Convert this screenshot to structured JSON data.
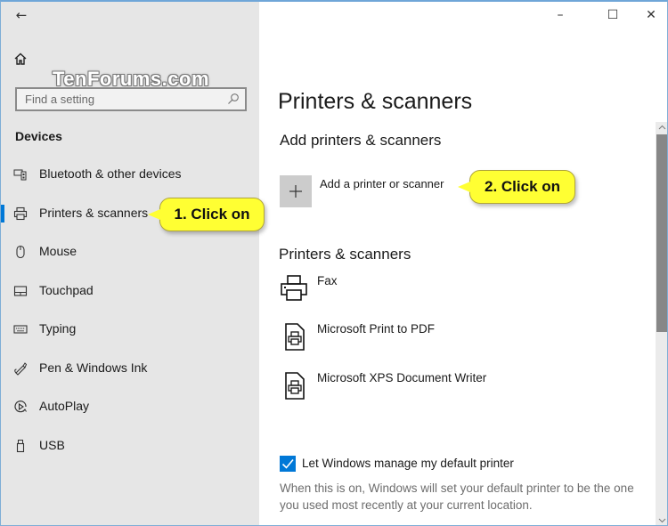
{
  "window": {
    "minimize_glyph": "–",
    "maximize_glyph": "☐",
    "close_glyph": "✕"
  },
  "sidebar": {
    "back_glyph": "←",
    "watermark": "TenForums.com",
    "search": {
      "placeholder": "Find a setting",
      "value": ""
    },
    "section_title": "Devices",
    "items": [
      {
        "label": "Bluetooth & other devices",
        "icon": "bluetooth-devices-icon",
        "selected": false
      },
      {
        "label": "Printers & scanners",
        "icon": "printer-icon",
        "selected": true
      },
      {
        "label": "Mouse",
        "icon": "mouse-icon",
        "selected": false
      },
      {
        "label": "Touchpad",
        "icon": "touchpad-icon",
        "selected": false
      },
      {
        "label": "Typing",
        "icon": "keyboard-icon",
        "selected": false
      },
      {
        "label": "Pen & Windows Ink",
        "icon": "pen-icon",
        "selected": false
      },
      {
        "label": "AutoPlay",
        "icon": "autoplay-icon",
        "selected": false
      },
      {
        "label": "USB",
        "icon": "usb-icon",
        "selected": false
      }
    ]
  },
  "callouts": {
    "step1": "1. Click on",
    "step2": "2. Click on"
  },
  "main": {
    "page_title": "Printers & scanners",
    "add_section_title": "Add printers & scanners",
    "add_button_label": "Add a printer or scanner",
    "list_section_title": "Printers & scanners",
    "printers": [
      {
        "name": "Fax",
        "icon": "printer-icon"
      },
      {
        "name": "Microsoft Print to PDF",
        "icon": "document-printer-icon"
      },
      {
        "name": "Microsoft XPS Document Writer",
        "icon": "document-printer-icon"
      }
    ],
    "default_printer_checkbox": {
      "label": "Let Windows manage my default printer",
      "checked": true
    },
    "default_printer_description": "When this is on, Windows will set your default printer to be the one you used most recently at your current location."
  },
  "scrollbar": {
    "up_glyph": "^",
    "down_glyph": "v"
  },
  "colors": {
    "accent": "#0078d7",
    "sidebar_bg": "#e6e6e6",
    "callout": "#ffff33"
  }
}
